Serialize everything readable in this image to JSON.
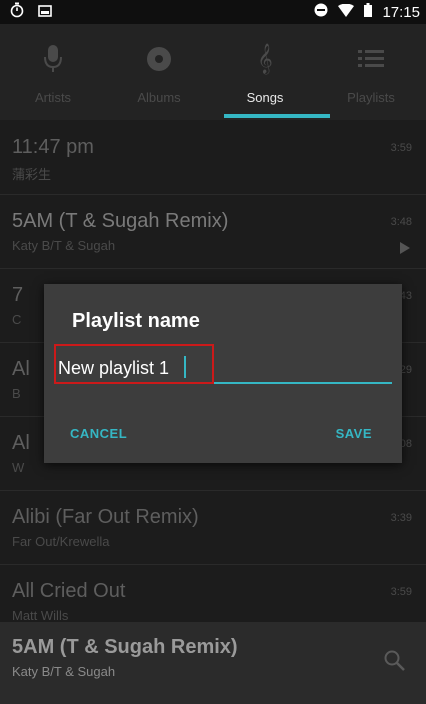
{
  "status": {
    "time": "17:15"
  },
  "tabs": [
    {
      "label": "Artists",
      "icon": "mic-icon"
    },
    {
      "label": "Albums",
      "icon": "disc-icon"
    },
    {
      "label": "Songs",
      "icon": "music-note-icon"
    },
    {
      "label": "Playlists",
      "icon": "playlist-icon"
    }
  ],
  "songs": [
    {
      "title": "11:47 pm",
      "artist": "蒲彩生",
      "duration": "3:59"
    },
    {
      "title": "5AM (T & Sugah Remix)",
      "artist": "Katy B/T & Sugah",
      "duration": "3:48"
    },
    {
      "title": "7",
      "artist": "C",
      "duration": "43"
    },
    {
      "title": "Al",
      "artist": "B",
      "duration": "29"
    },
    {
      "title": "Al",
      "artist": "W",
      "duration": "08"
    },
    {
      "title": "Alibi (Far Out Remix)",
      "artist": "Far Out/Krewella",
      "duration": "3:39"
    },
    {
      "title": "All Cried Out",
      "artist": "Matt Wills",
      "duration": "3:59"
    }
  ],
  "dialog": {
    "title": "Playlist name",
    "input_value": "New playlist 1",
    "cancel": "CANCEL",
    "save": "SAVE"
  },
  "now_playing": {
    "title": "5AM (T & Sugah Remix)",
    "artist": "Katy B/T & Sugah"
  },
  "colors": {
    "accent": "#35b7c4",
    "highlight_box": "#cc1a1a"
  }
}
